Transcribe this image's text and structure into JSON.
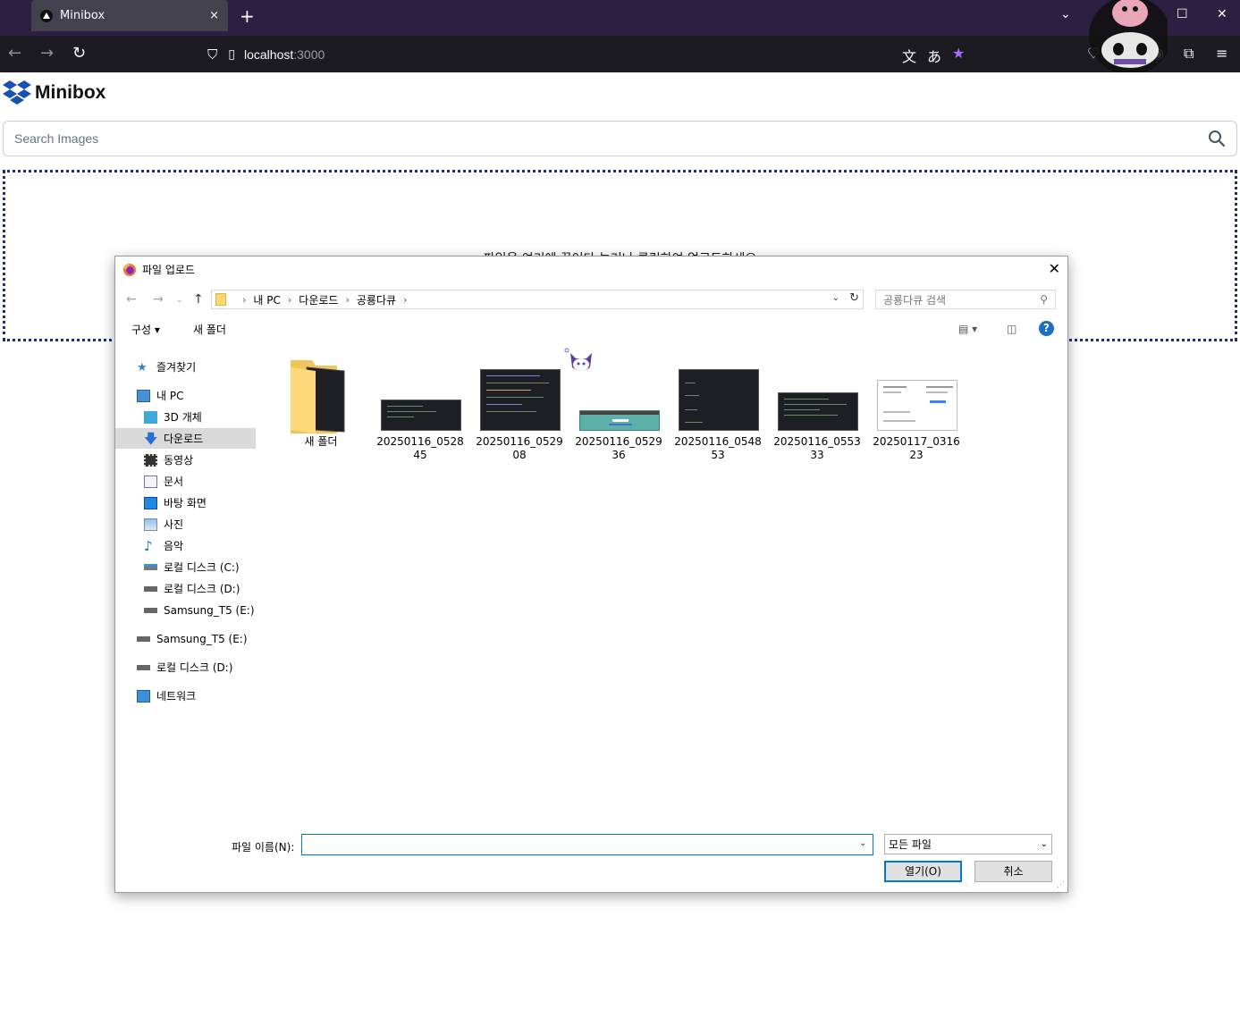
{
  "browser": {
    "tab_title": "Minibox",
    "tab_close": "×",
    "new_tab": "+",
    "url_host": "localhost",
    "url_port": ":3000"
  },
  "page": {
    "brand_name": "Minibox",
    "search_placeholder": "Search Images",
    "dropzone_text": "파일을 여기에 끌어다 놓거나 클릭하여 업로드하세요"
  },
  "dialog": {
    "title": "파일 업로드",
    "breadcrumb": [
      "내 PC",
      "다운로드",
      "공룡다큐"
    ],
    "search_placeholder": "공룡다큐 검색",
    "toolbar": {
      "organize": "구성 ▾",
      "new_folder": "새 폴더"
    },
    "help": "?",
    "sidebar": [
      {
        "label": "즐겨찾기",
        "icon": "star-icon"
      },
      {
        "label": "내 PC",
        "icon": "computer-icon"
      },
      {
        "label": "3D 개체",
        "icon": "cube-icon"
      },
      {
        "label": "다운로드",
        "icon": "download-arrow-icon"
      },
      {
        "label": "동영상",
        "icon": "film-icon"
      },
      {
        "label": "문서",
        "icon": "document-icon"
      },
      {
        "label": "바탕 화면",
        "icon": "desktop-icon"
      },
      {
        "label": "사진",
        "icon": "picture-icon"
      },
      {
        "label": "음악",
        "icon": "music-note-icon"
      },
      {
        "label": "로컬 디스크 (C:)",
        "icon": "drive-icon"
      },
      {
        "label": "로컬 디스크 (D:)",
        "icon": "drive-icon"
      },
      {
        "label": "Samsung_T5 (E:)",
        "icon": "drive-icon"
      },
      {
        "label": "Samsung_T5 (E:)",
        "icon": "drive-icon"
      },
      {
        "label": "로컬 디스크 (D:)",
        "icon": "drive-icon"
      },
      {
        "label": "네트워크",
        "icon": "network-icon"
      }
    ],
    "files": [
      {
        "name": "새 폴더"
      },
      {
        "name": "20250116_052845"
      },
      {
        "name": "20250116_052908"
      },
      {
        "name": "20250116_052936"
      },
      {
        "name": "20250116_054853"
      },
      {
        "name": "20250116_055333"
      },
      {
        "name": "20250117_031623"
      }
    ],
    "filename_label": "파일 이름(N):",
    "filename_value": "",
    "filetype": "모든 파일",
    "open_button": "열기(O)",
    "cancel_button": "취소"
  },
  "colors": {
    "tabbar": "#2b2041",
    "navbar": "#1c1b22",
    "dropzone_border": "#1f2d78",
    "accent": "#0078d7",
    "bookmark_star": "#a76bff"
  }
}
